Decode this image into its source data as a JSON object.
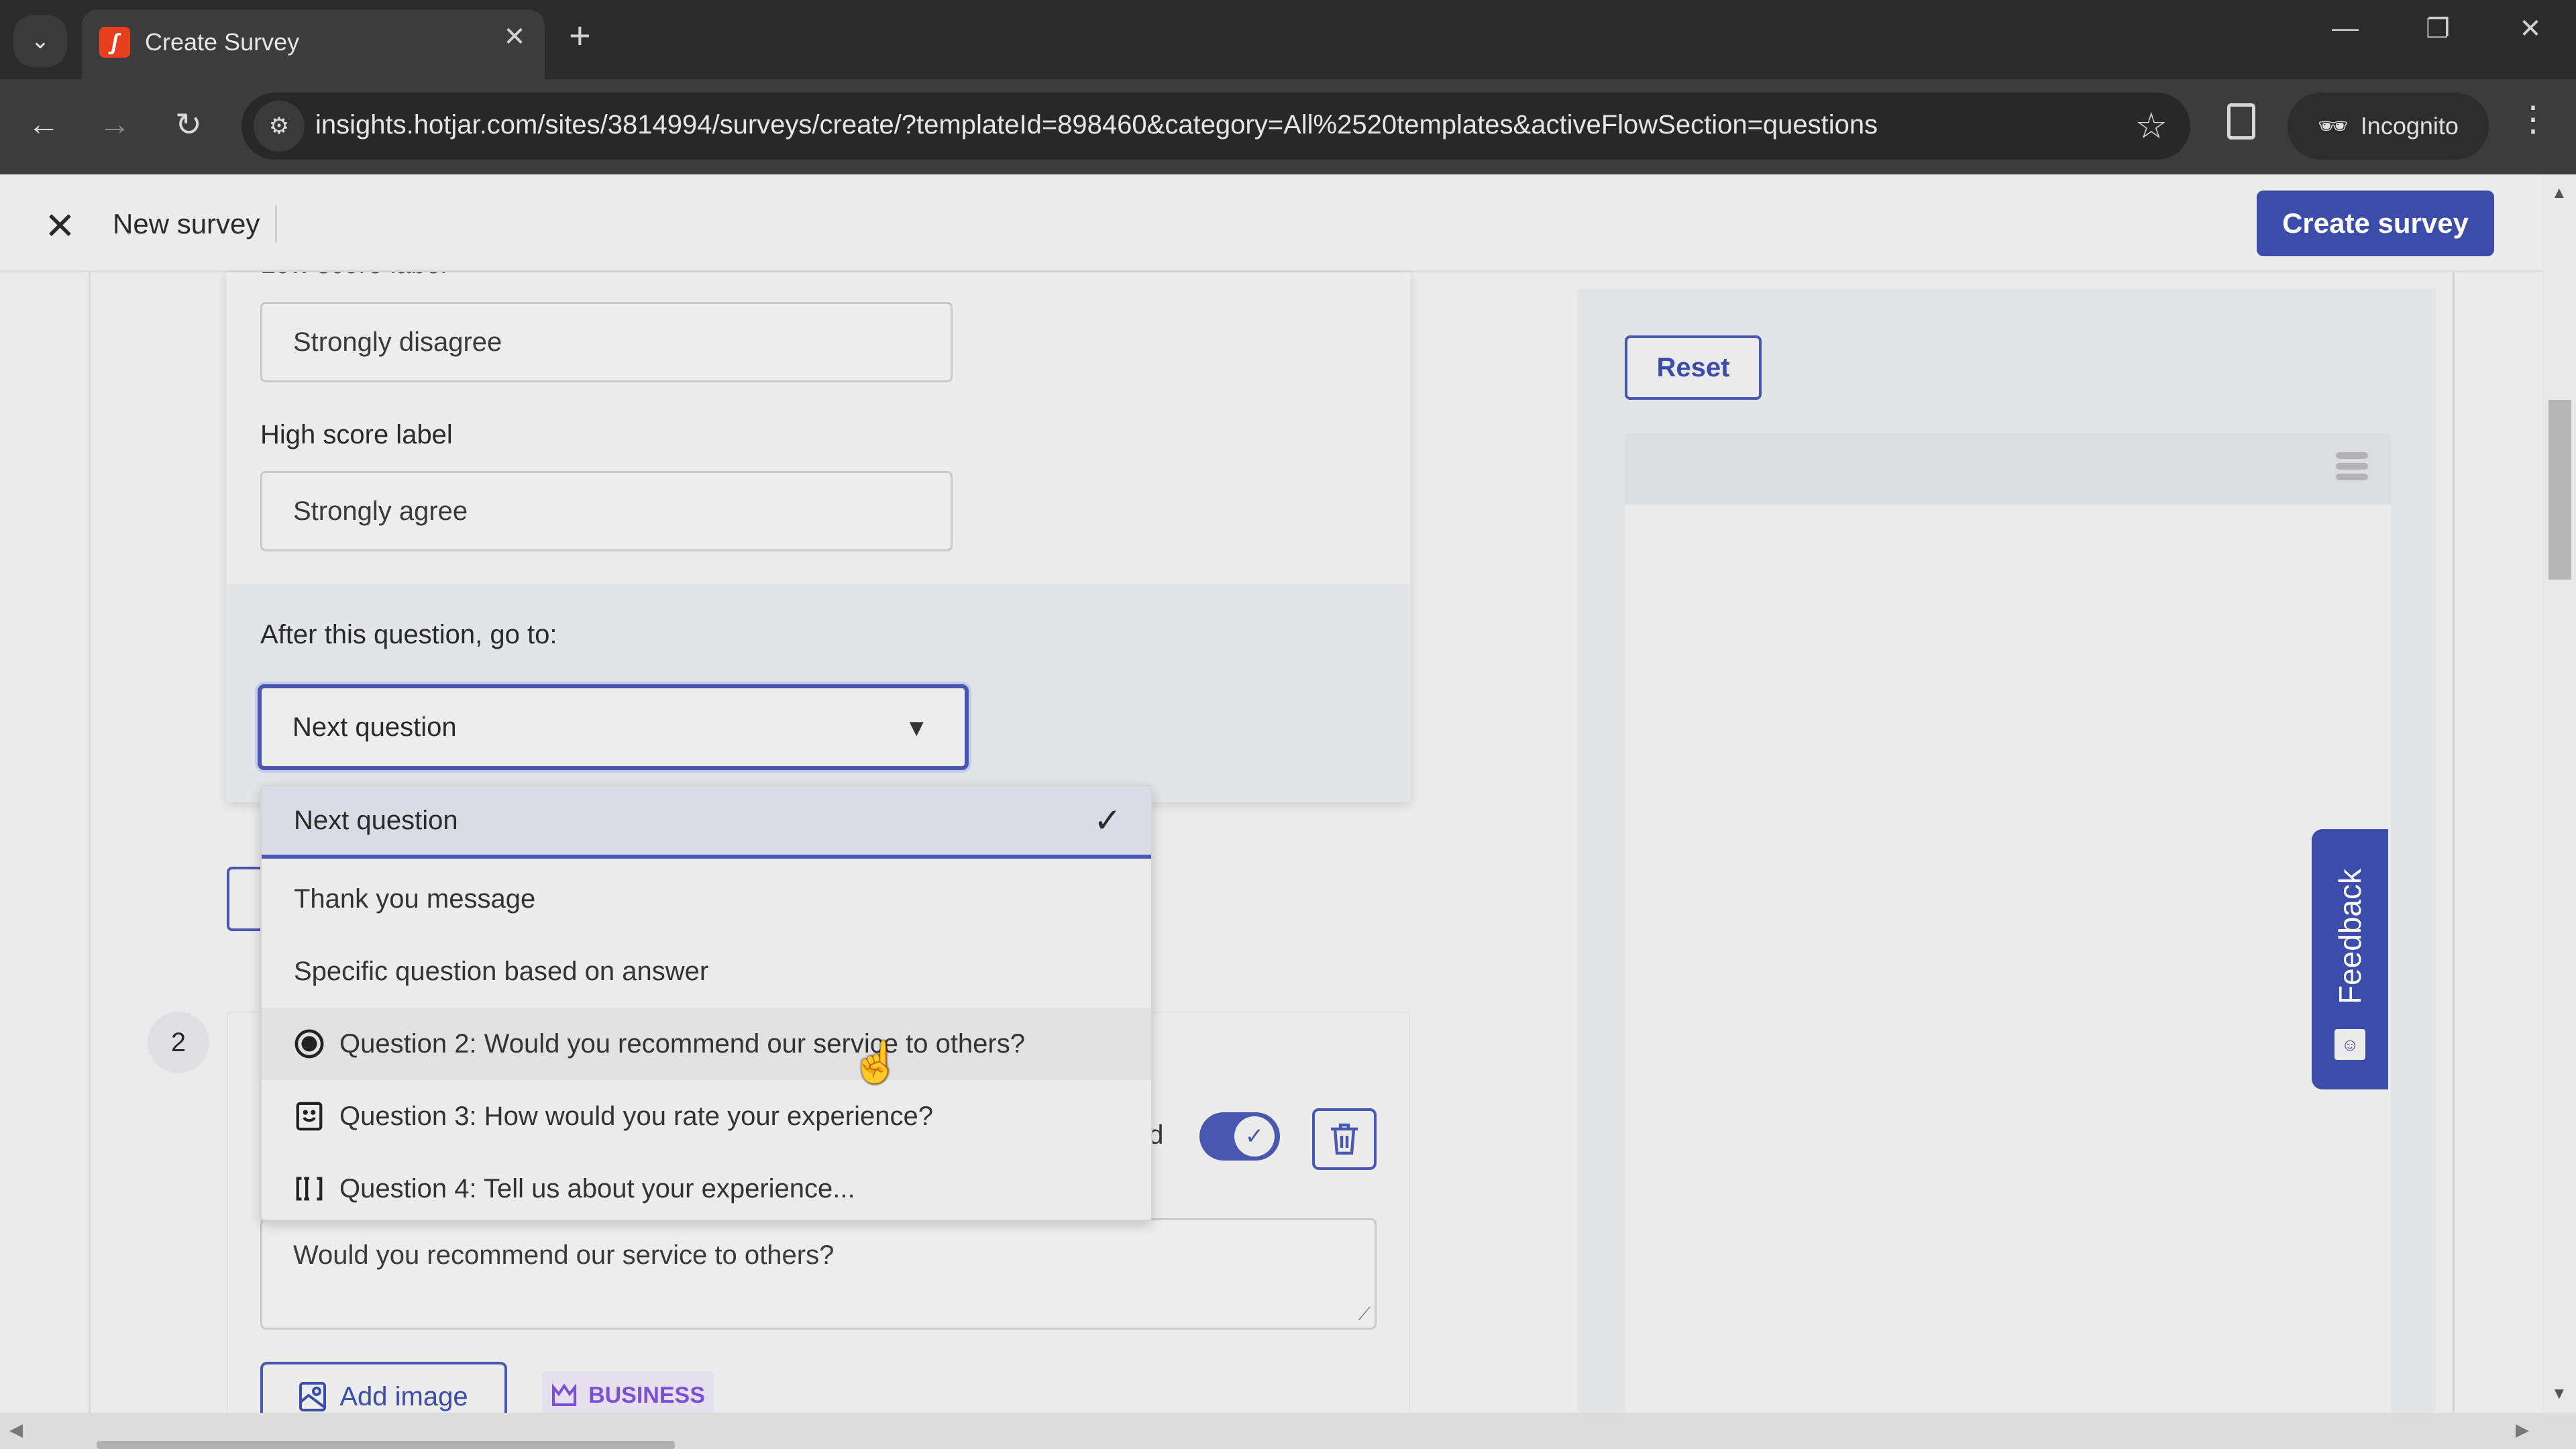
{
  "browser": {
    "tab_title": "Create Survey",
    "url": "insights.hotjar.com/sites/3814994/surveys/create/?templateId=898460&category=All%2520templates&activeFlowSection=questions",
    "incognito_label": "Incognito"
  },
  "header": {
    "title": "New survey",
    "create_button": "Create survey"
  },
  "question1": {
    "low_score_label": "Low score label",
    "low_score_value": "Strongly disagree",
    "high_score_label": "High score label",
    "high_score_value": "Strongly agree",
    "goto_label": "After this question, go to:",
    "goto_value": "Next question"
  },
  "dropdown": {
    "options": [
      {
        "label": "Next question",
        "selected": true
      },
      {
        "label": "Thank you message"
      },
      {
        "label": "Specific question based on answer"
      },
      {
        "label": "Question 2: Would you recommend our service to others?",
        "icon": "radio-icon"
      },
      {
        "label": "Question 3: How would you rate your experience?",
        "icon": "smiley-icon"
      },
      {
        "label": "Question 4: Tell us about your experience...",
        "icon": "text-field-icon"
      }
    ]
  },
  "question2": {
    "number": "2",
    "required_label_partial": "ed",
    "required_on": true,
    "text": "Would you recommend our service to others?",
    "add_image_label": "Add image",
    "business_badge": "BUSINESS"
  },
  "preview": {
    "reset_label": "Reset",
    "feedback_label": "Feedback"
  },
  "colors": {
    "accent": "#3c4cab",
    "business": "#7b4fd6",
    "favicon": "#e8401f"
  }
}
